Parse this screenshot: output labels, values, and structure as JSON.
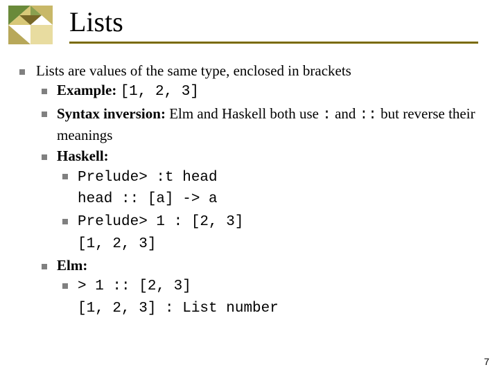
{
  "slide": {
    "title": "Lists",
    "page_number": "7",
    "main_point": "Lists are values of the same type, enclosed in brackets",
    "example": {
      "label": "Example:",
      "code": "[1, 2, 3]"
    },
    "syntax_inversion": {
      "label": "Syntax inversion:",
      "text_part1": " Elm and Haskell both use ",
      "code1": ":",
      "text_part2": " and ",
      "code2": "::",
      "text_part3": " but reverse their meanings"
    },
    "haskell": {
      "label": "Haskell:",
      "line1a": "Prelude> :t head",
      "line1b": "head :: [a] -> a",
      "line2a": "Prelude> 1 : [2, 3]",
      "line2b": "[1, 2, 3]"
    },
    "elm": {
      "label": "Elm:",
      "line1a": "> 1 :: [2, 3]",
      "line1b": "[1, 2, 3] : List number"
    }
  }
}
